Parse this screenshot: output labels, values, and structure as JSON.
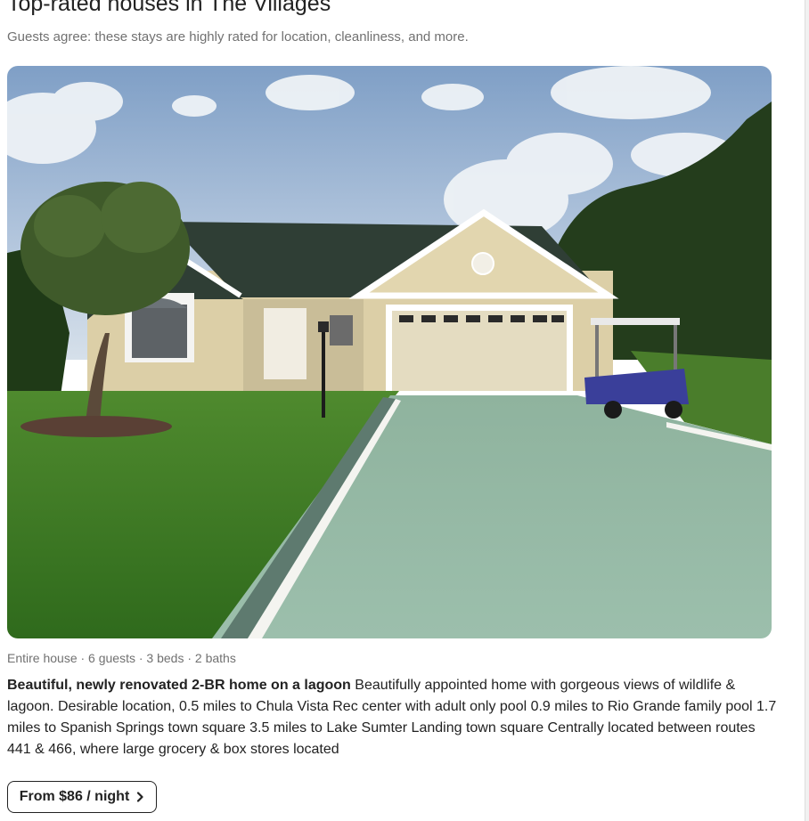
{
  "section": {
    "title": "Top-rated houses in The Villages",
    "subtitle": "Guests agree: these stays are highly rated for location, cleanliness, and more."
  },
  "listing": {
    "photo_icon": "house-photo",
    "details": "Entire house · 6 guests · 3 beds · 2 baths",
    "title": "Beautiful, newly renovated 2-BR home on a lagoon",
    "description": "Beautifully appointed home with gorgeous views of wildlife & lagoon. Desirable location, 0.5 miles to Chula Vista Rec center with adult only pool 0.9 miles to Rio Grande family pool 1.7 miles to Spanish Springs town square 3.5 miles to Lake Sumter Landing town square Centrally located between routes 441 & 466, where large grocery & box stores located",
    "price_label": "From $86 / night",
    "price_icon": "chevron-right-icon"
  },
  "colors": {
    "text_primary": "#222222",
    "text_secondary": "#717171",
    "border": "#222222"
  }
}
